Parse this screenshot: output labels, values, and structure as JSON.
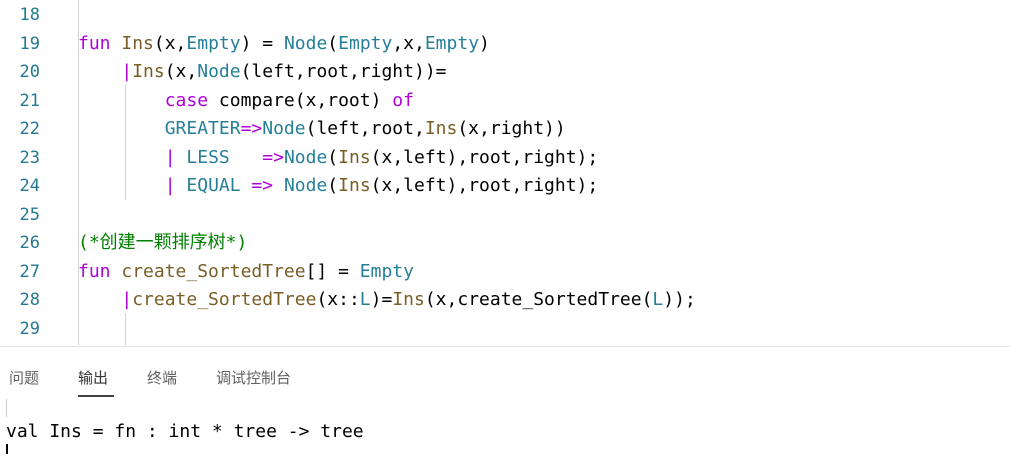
{
  "editor": {
    "lines": [
      {
        "num": "18",
        "tokens": []
      },
      {
        "num": "19",
        "tokens": [
          {
            "t": "fun ",
            "c": "kw"
          },
          {
            "t": "Ins",
            "c": "fn"
          },
          {
            "t": "(x,",
            "c": "tx"
          },
          {
            "t": "Empty",
            "c": "cn"
          },
          {
            "t": ") = ",
            "c": "tx"
          },
          {
            "t": "Node",
            "c": "cn"
          },
          {
            "t": "(",
            "c": "tx"
          },
          {
            "t": "Empty",
            "c": "cn"
          },
          {
            "t": ",x,",
            "c": "tx"
          },
          {
            "t": "Empty",
            "c": "cn"
          },
          {
            "t": ")",
            "c": "tx"
          }
        ]
      },
      {
        "num": "20",
        "tokens": [
          {
            "t": "    ",
            "c": "tx"
          },
          {
            "t": "|",
            "c": "bar"
          },
          {
            "t": "Ins",
            "c": "fn"
          },
          {
            "t": "(x,",
            "c": "tx"
          },
          {
            "t": "Node",
            "c": "cn"
          },
          {
            "t": "(left,root,right))=",
            "c": "tx"
          }
        ]
      },
      {
        "num": "21",
        "tokens": [
          {
            "t": "        ",
            "c": "tx"
          },
          {
            "t": "case ",
            "c": "kw"
          },
          {
            "t": "compare(x,root) ",
            "c": "tx"
          },
          {
            "t": "of",
            "c": "kw"
          }
        ]
      },
      {
        "num": "22",
        "tokens": [
          {
            "t": "        ",
            "c": "tx"
          },
          {
            "t": "GREATER",
            "c": "cn"
          },
          {
            "t": "=>",
            "c": "kw"
          },
          {
            "t": "Node",
            "c": "cn"
          },
          {
            "t": "(left,root,",
            "c": "tx"
          },
          {
            "t": "Ins",
            "c": "fn"
          },
          {
            "t": "(x,right))",
            "c": "tx"
          }
        ]
      },
      {
        "num": "23",
        "tokens": [
          {
            "t": "        ",
            "c": "tx"
          },
          {
            "t": "| ",
            "c": "kw"
          },
          {
            "t": "LESS   ",
            "c": "cn"
          },
          {
            "t": "=>",
            "c": "kw"
          },
          {
            "t": "Node",
            "c": "cn"
          },
          {
            "t": "(",
            "c": "tx"
          },
          {
            "t": "Ins",
            "c": "fn"
          },
          {
            "t": "(x,left),root,right);",
            "c": "tx"
          }
        ]
      },
      {
        "num": "24",
        "tokens": [
          {
            "t": "        ",
            "c": "tx"
          },
          {
            "t": "| ",
            "c": "kw"
          },
          {
            "t": "EQUAL ",
            "c": "cn"
          },
          {
            "t": "=> ",
            "c": "kw"
          },
          {
            "t": "Node",
            "c": "cn"
          },
          {
            "t": "(",
            "c": "tx"
          },
          {
            "t": "Ins",
            "c": "fn"
          },
          {
            "t": "(x,left),root,right);",
            "c": "tx"
          }
        ]
      },
      {
        "num": "25",
        "tokens": []
      },
      {
        "num": "26",
        "tokens": [
          {
            "t": "(*创建一颗排序树*)",
            "c": "cm"
          }
        ]
      },
      {
        "num": "27",
        "tokens": [
          {
            "t": "fun ",
            "c": "kw"
          },
          {
            "t": "create_SortedTree",
            "c": "fn"
          },
          {
            "t": "[] = ",
            "c": "tx"
          },
          {
            "t": "Empty",
            "c": "cn"
          }
        ]
      },
      {
        "num": "28",
        "tokens": [
          {
            "t": "    ",
            "c": "tx"
          },
          {
            "t": "|",
            "c": "bar"
          },
          {
            "t": "create_SortedTree",
            "c": "fn"
          },
          {
            "t": "(x::",
            "c": "tx"
          },
          {
            "t": "L",
            "c": "cn"
          },
          {
            "t": ")=",
            "c": "tx"
          },
          {
            "t": "Ins",
            "c": "fn"
          },
          {
            "t": "(x,create_SortedTree(",
            "c": "tx"
          },
          {
            "t": "L",
            "c": "cn"
          },
          {
            "t": "));",
            "c": "tx"
          }
        ]
      },
      {
        "num": "29",
        "tokens": []
      }
    ]
  },
  "panel": {
    "tabs": [
      "问题",
      "输出",
      "终端",
      "调试控制台"
    ],
    "active_tab": "输出",
    "output": "val Ins = fn : int * tree -> tree"
  }
}
